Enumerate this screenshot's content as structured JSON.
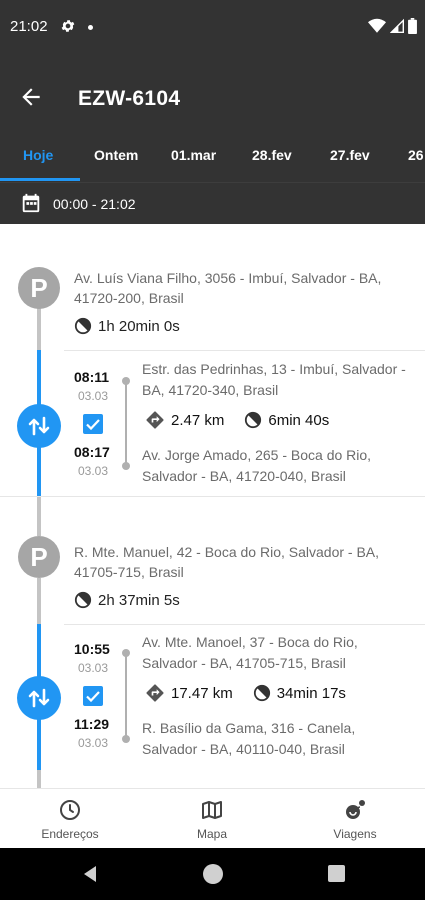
{
  "status_bar": {
    "time": "21:02"
  },
  "app_bar": {
    "title": "EZW-6104"
  },
  "tabs": [
    {
      "label": "Hoje",
      "active": true
    },
    {
      "label": "Ontem",
      "active": false
    },
    {
      "label": "01.mar",
      "active": false
    },
    {
      "label": "28.fev",
      "active": false
    },
    {
      "label": "27.fev",
      "active": false
    },
    {
      "label": "26",
      "active": false
    }
  ],
  "date_range": {
    "text": "00:00 - 21:02"
  },
  "stops": [
    {
      "icon_letter": "P",
      "address": "Av. Luís Viana Filho, 3056 - Imbuí, Salvador - BA, 41720-200, Brasil",
      "duration": "1h 20min 0s"
    },
    {
      "icon_letter": "P",
      "address": "R. Mte. Manuel, 42 - Boca do Rio, Salvador - BA, 41705-715, Brasil",
      "duration": "2h 37min 5s"
    }
  ],
  "trips": [
    {
      "start_time": "08:11",
      "start_date": "03.03",
      "end_time": "08:17",
      "end_date": "03.03",
      "start_address": "Estr. das Pedrinhas, 13 - Imbuí, Salvador - BA, 41720-340, Brasil",
      "end_address": "Av. Jorge Amado, 265 - Boca do Rio, Salvador - BA, 41720-040, Brasil",
      "distance": "2.47 km",
      "duration": "6min 40s",
      "checked": true
    },
    {
      "start_time": "10:55",
      "start_date": "03.03",
      "end_time": "11:29",
      "end_date": "03.03",
      "start_address": "Av. Mte. Manoel, 37 - Boca do Rio, Salvador - BA, 41705-715, Brasil",
      "end_address": "R. Basílio da Gama, 316 - Canela, Salvador - BA, 40110-040, Brasil",
      "distance": "17.47 km",
      "duration": "34min 17s",
      "checked": true
    }
  ],
  "bottom_nav": [
    {
      "label": "Endereços",
      "icon": "clock-icon"
    },
    {
      "label": "Mapa",
      "icon": "map-icon"
    },
    {
      "label": "Viagens",
      "icon": "trips-icon"
    }
  ],
  "colors": {
    "accent": "#2196F3",
    "appbar": "#333333",
    "stop_gray": "#a6a6a6"
  }
}
